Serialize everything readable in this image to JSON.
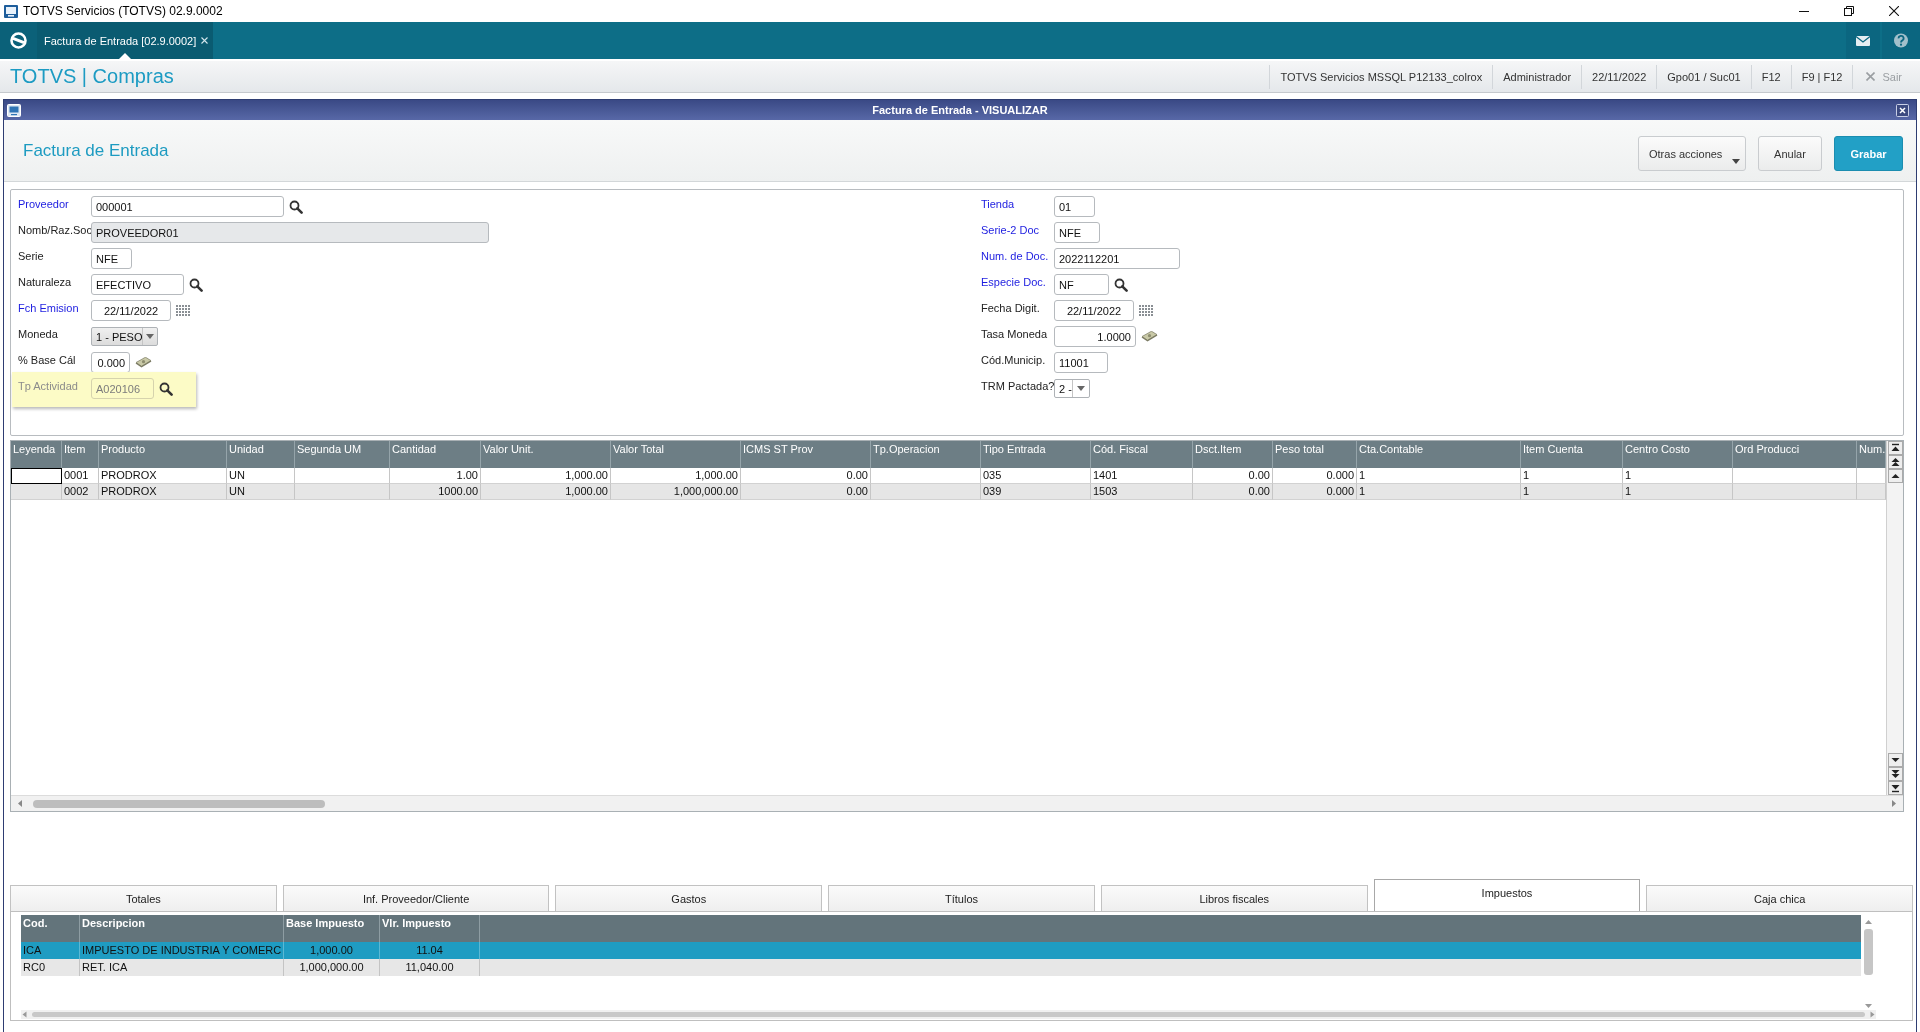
{
  "window": {
    "title": "TOTVS Servicios (TOTVS) 02.9.0002"
  },
  "app_bar": {
    "tabs": [
      {
        "label": "Factura de Entrada [02.9.0002]",
        "selected": true
      }
    ]
  },
  "breadcrumb": {
    "title": "TOTVS | Compras",
    "items": [
      "TOTVS Servicios MSSQL P12133_colrox",
      "Administrador",
      "22/11/2022",
      "Gpo01 / Suc01",
      "F12",
      "F9 | F12"
    ],
    "exit": {
      "label": "Sair",
      "disabled": true
    }
  },
  "dialog": {
    "title": "Factura de Entrada - VISUALIZAR",
    "heading": "Factura de Entrada",
    "buttons": [
      {
        "label": "Otras acciones",
        "kind": "menu"
      },
      {
        "label": "Anular",
        "kind": "default"
      },
      {
        "label": "Grabar",
        "kind": "primary"
      }
    ]
  },
  "form": {
    "left": [
      {
        "label": "Proveedor",
        "value": "000001",
        "kind": "lookup",
        "required": true,
        "readonly": false,
        "disabled": false,
        "highlighted": false
      },
      {
        "label": "Nomb/Raz.Soc",
        "value": "PROVEEDOR01",
        "kind": "text",
        "required": false,
        "readonly": true,
        "disabled": false,
        "highlighted": false
      },
      {
        "label": "Serie",
        "value": "NFE",
        "kind": "text",
        "required": false,
        "readonly": false,
        "disabled": false,
        "highlighted": false
      },
      {
        "label": "Naturaleza",
        "value": "EFECTIVO",
        "kind": "lookup",
        "required": false,
        "readonly": false,
        "disabled": false,
        "highlighted": false
      },
      {
        "label": "Fch Emision",
        "value": "22/11/2022",
        "kind": "date",
        "required": true,
        "readonly": false,
        "disabled": false,
        "highlighted": false
      },
      {
        "label": "Moneda",
        "value": "1 - PESO",
        "kind": "select",
        "required": false,
        "readonly": true,
        "disabled": false,
        "highlighted": false
      },
      {
        "label": "% Base Cál",
        "value": "0.000",
        "kind": "calc",
        "required": false,
        "readonly": false,
        "disabled": false,
        "highlighted": false
      },
      {
        "label": "Tp Actividad",
        "value": "A020106",
        "kind": "lookup",
        "required": false,
        "readonly": false,
        "disabled": true,
        "highlighted": true
      }
    ],
    "right": [
      {
        "label": "Tienda",
        "value": "01",
        "kind": "text",
        "required": true,
        "readonly": false,
        "disabled": false,
        "highlighted": false
      },
      {
        "label": "Serie-2 Doc",
        "value": "NFE",
        "kind": "text",
        "required": true,
        "readonly": false,
        "disabled": false,
        "highlighted": false
      },
      {
        "label": "Num. de Doc.",
        "value": "2022112201",
        "kind": "text",
        "required": true,
        "readonly": false,
        "disabled": false,
        "highlighted": false
      },
      {
        "label": "Especie Doc.",
        "value": "NF",
        "kind": "lookup",
        "required": true,
        "readonly": false,
        "disabled": false,
        "highlighted": false
      },
      {
        "label": "Fecha Digit.",
        "value": "22/11/2022",
        "kind": "date",
        "required": false,
        "readonly": false,
        "disabled": false,
        "highlighted": false
      },
      {
        "label": "Tasa Moneda",
        "value": "1.0000",
        "kind": "calc",
        "required": false,
        "readonly": false,
        "disabled": false,
        "highlighted": false
      },
      {
        "label": "Cód.Municip.",
        "value": "11001",
        "kind": "text",
        "required": false,
        "readonly": false,
        "disabled": false,
        "highlighted": false
      },
      {
        "label": "TRM Pactada?",
        "value": "2 -",
        "kind": "select",
        "required": false,
        "readonly": false,
        "disabled": false,
        "highlighted": false
      }
    ]
  },
  "grid": {
    "columns": [
      {
        "label": "Leyenda",
        "kind": "text"
      },
      {
        "label": "Item",
        "kind": "text"
      },
      {
        "label": "Producto",
        "kind": "text"
      },
      {
        "label": "Unidad",
        "kind": "text"
      },
      {
        "label": "Segunda UM",
        "kind": "text"
      },
      {
        "label": "Cantidad",
        "kind": "number"
      },
      {
        "label": "Valor Unit.",
        "kind": "number"
      },
      {
        "label": "Valor Total",
        "kind": "number"
      },
      {
        "label": "ICMS ST Prov",
        "kind": "number"
      },
      {
        "label": "Tp.Operacion",
        "kind": "text"
      },
      {
        "label": "Tipo Entrada",
        "kind": "text"
      },
      {
        "label": "Cód. Fiscal",
        "kind": "text"
      },
      {
        "label": "Dsct.Item",
        "kind": "number"
      },
      {
        "label": "Peso total",
        "kind": "number"
      },
      {
        "label": "Cta.Contable",
        "kind": "text"
      },
      {
        "label": "Item Cuenta",
        "kind": "text"
      },
      {
        "label": "Centro Costo",
        "kind": "text"
      },
      {
        "label": "Ord Producci",
        "kind": "text"
      },
      {
        "label": "Num.",
        "kind": "text"
      }
    ],
    "rows": [
      {
        "selected": true,
        "cells": [
          null,
          "0001",
          "PRODROX",
          "UN",
          null,
          "1.00",
          "1,000.00",
          "1,000.00",
          "0.00",
          null,
          "035",
          "1401",
          "0.00",
          "0.000",
          "1",
          "1",
          "1",
          null,
          null
        ]
      },
      {
        "selected": false,
        "cells": [
          null,
          "0002",
          "PRODROX",
          "UN",
          null,
          "1000.00",
          "1,000.00",
          "1,000,000.00",
          "0.00",
          null,
          "039",
          "1503",
          "0.00",
          "0.000",
          "1",
          "1",
          "1",
          null,
          null
        ]
      }
    ]
  },
  "tabs": [
    {
      "label": "Totales",
      "selected": false
    },
    {
      "label": "Inf. Proveedor/Cliente",
      "selected": false
    },
    {
      "label": "Gastos",
      "selected": false
    },
    {
      "label": "Títulos",
      "selected": false
    },
    {
      "label": "Libros fiscales",
      "selected": false
    },
    {
      "label": "Impuestos",
      "selected": true
    },
    {
      "label": "Caja chica",
      "selected": false
    }
  ],
  "taxes": {
    "columns": [
      {
        "label": "Cod.",
        "kind": "text"
      },
      {
        "label": "Descripcion",
        "kind": "text"
      },
      {
        "label": "Base Impuesto",
        "kind": "number"
      },
      {
        "label": "Vlr. Impuesto",
        "kind": "number"
      }
    ],
    "rows": [
      {
        "selected": true,
        "cells": [
          "ICA",
          "IMPUESTO DE INDUSTRIA Y COMERC",
          "1,000.00",
          "11.04"
        ]
      },
      {
        "selected": false,
        "cells": [
          "RC0",
          "RET. ICA",
          "1,000,000.00",
          "11,040.00"
        ]
      }
    ]
  }
}
